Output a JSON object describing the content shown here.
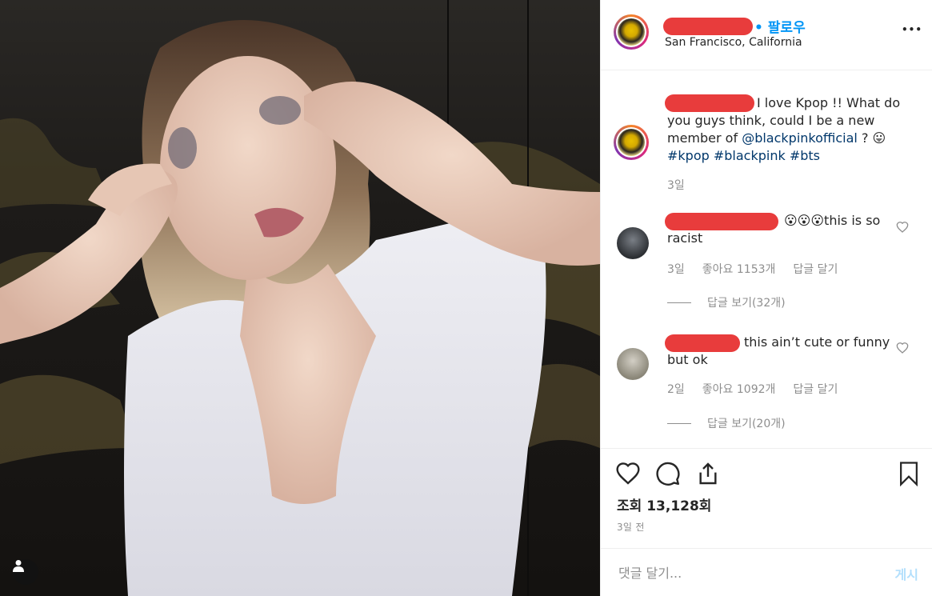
{
  "post": {
    "username": "",
    "follow_label": "• 팔로우",
    "location": "San Francisco, California",
    "more_label": "•••"
  },
  "caption": {
    "text_before": "I love Kpop !! What do you guys think, could I be a new member of",
    "mention": "@blackpinkofficial",
    "text_after": " ? 😛",
    "hashtags": "#kpop #blackpink #bts",
    "time": "3일"
  },
  "comments": [
    {
      "text_emojis": "😮😮😮",
      "text": "this is so racist",
      "time": "3일",
      "likes": "좋아요 1153개",
      "reply": "답글 달기",
      "view_replies": "답글 보기(32개)"
    },
    {
      "text": "this ain’t cute or funny but ok",
      "time": "2일",
      "likes": "좋아요 1092개",
      "reply": "답글 달기",
      "view_replies": "답글 보기(20개)"
    }
  ],
  "stats": {
    "views": "조회 13,128회",
    "posted": "3일 전"
  },
  "comment_input": {
    "placeholder": "댓글 달기...",
    "post_label": "게시"
  },
  "icons": {
    "like": "heart-icon",
    "comment": "comment-bubble-icon",
    "share": "share-icon",
    "save": "bookmark-icon",
    "user_tag": "user-tag-icon"
  },
  "colors": {
    "accent": "#0095f6",
    "link": "#00376b",
    "muted": "#8e8e8e",
    "redaction": "#e83c3c"
  }
}
